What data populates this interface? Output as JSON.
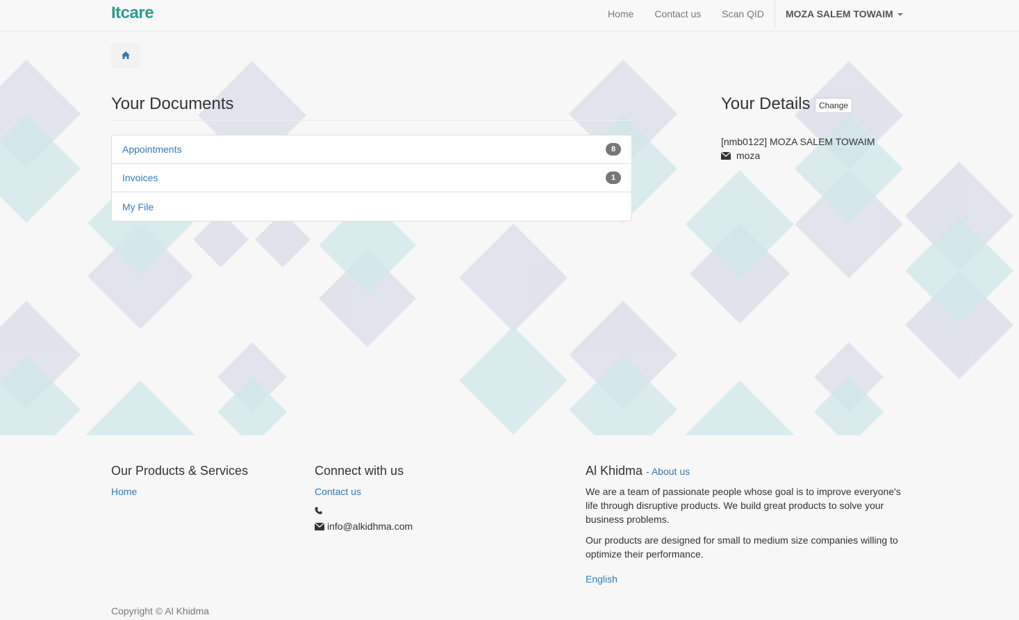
{
  "navbar": {
    "logo": "Itcare",
    "links": [
      "Home",
      "Contact us",
      "Scan QID"
    ],
    "user": "MOZA SALEM TOWAIM"
  },
  "documents": {
    "title": "Your Documents",
    "items": [
      {
        "label": "Appointments",
        "count": "8"
      },
      {
        "label": "Invoices",
        "count": "1"
      },
      {
        "label": "My File",
        "count": ""
      }
    ]
  },
  "details": {
    "title": "Your Details",
    "change_label": "Change",
    "name": "[nmb0122] MOZA SALEM TOWAIM",
    "email": "moza"
  },
  "footer": {
    "products_title": "Our Products & Services",
    "products_link": "Home",
    "connect_title": "Connect with us",
    "connect_link": "Contact us",
    "phone": "",
    "email": "info@alkidhma.com",
    "about_title": "Al Khidma",
    "about_link": "- About us",
    "about_p1": "We are a team of passionate people whose goal is to improve everyone's life through disruptive products. We build great products to solve your business problems.",
    "about_p2": "Our products are designed for small to medium size companies willing to optimize their performance.",
    "language": "English",
    "copyright": "Copyright © Al Khidma"
  },
  "colors": {
    "accent": "#2a9d8f",
    "link": "#337ab7",
    "badge": "#777777",
    "pattern_grey": "#d9dde8",
    "pattern_teal": "#cfe8ea"
  }
}
